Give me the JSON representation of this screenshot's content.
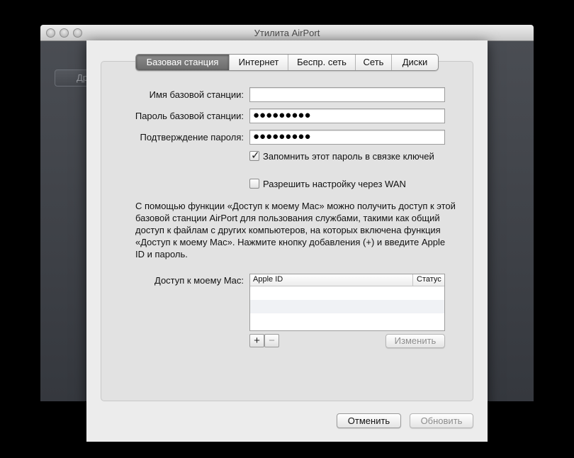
{
  "main_window": {
    "title": "Утилита AirPort",
    "left_button_fragment": "Др"
  },
  "tabs": [
    {
      "label": "Базовая станция",
      "active": true
    },
    {
      "label": "Интернет",
      "active": false
    },
    {
      "label": "Беспр. сеть",
      "active": false
    },
    {
      "label": "Сеть",
      "active": false
    },
    {
      "label": "Диски",
      "active": false
    }
  ],
  "form": {
    "base_name_label": "Имя базовой станции:",
    "base_name_value": "",
    "base_password_label": "Пароль базовой станции:",
    "base_password_value": "●●●●●●●●●",
    "confirm_password_label": "Подтверждение пароля:",
    "confirm_password_value": "●●●●●●●●●",
    "remember_password_label": "Запомнить этот пароль в связке ключей",
    "remember_password_checked": true,
    "allow_wan_label": "Разрешить настройку через WAN",
    "allow_wan_checked": false
  },
  "description": "С помощью функции «Доступ к моему Mac» можно получить доступ к этой базовой станции AirPort для пользования службами, такими как общий доступ к файлам с других компьютеров, на которых включена функция «Доступ к моему Mac». Нажмите кнопку добавления (+) и введите Apple ID и пароль.",
  "back_to_my_mac": {
    "label": "Доступ к моему Mac:",
    "columns": [
      "Apple ID",
      "Статус"
    ],
    "rows": [],
    "add_label": "+",
    "remove_label": "−",
    "edit_label": "Изменить"
  },
  "footer": {
    "cancel_label": "Отменить",
    "update_label": "Обновить"
  }
}
